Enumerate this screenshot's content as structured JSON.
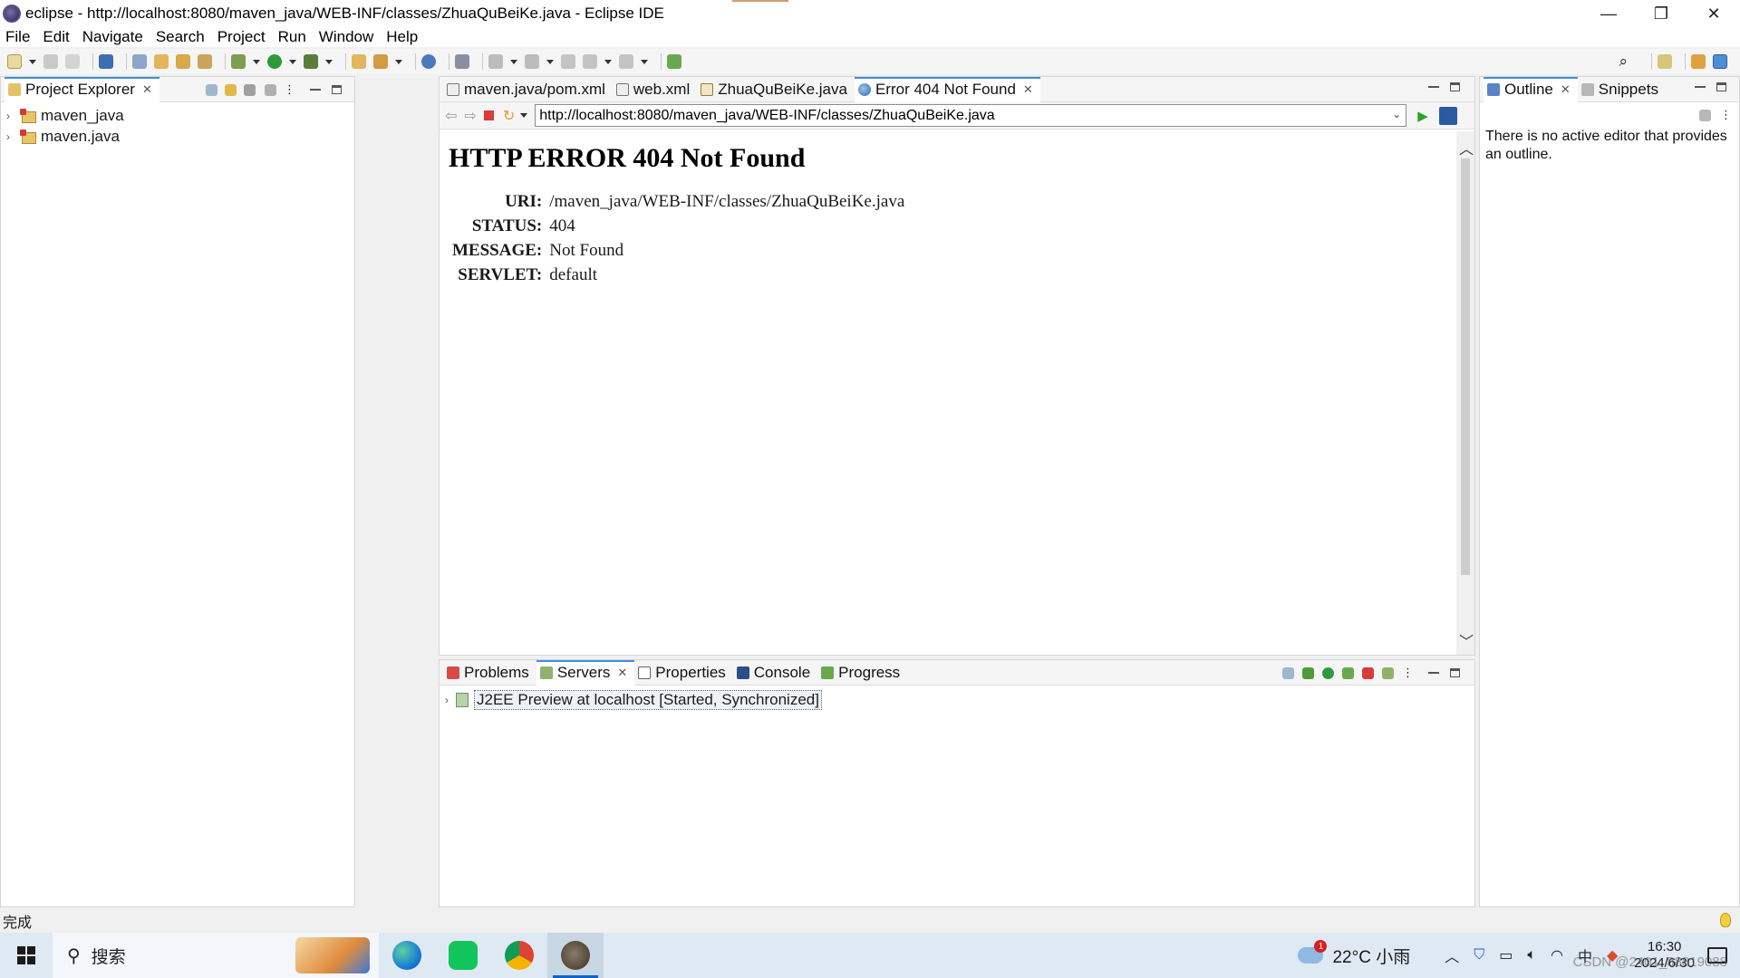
{
  "window": {
    "title": "eclipse - http://localhost:8080/maven_java/WEB-INF/classes/ZhuaQuBeiKe.java - Eclipse IDE",
    "minimize": "—",
    "restore": "❐",
    "close": "✕"
  },
  "menu": [
    "File",
    "Edit",
    "Navigate",
    "Search",
    "Project",
    "Run",
    "Window",
    "Help"
  ],
  "project_explorer": {
    "tab_label": "Project Explorer",
    "items": [
      {
        "label": "maven_java"
      },
      {
        "label": "maven.java"
      }
    ]
  },
  "editor": {
    "tabs": [
      {
        "label": "maven.java/pom.xml",
        "icon": "xml-file-icon"
      },
      {
        "label": "web.xml",
        "icon": "xml-file-icon"
      },
      {
        "label": "ZhuaQuBeiKe.java",
        "icon": "java-file-icon"
      },
      {
        "label": "Error 404 Not Found",
        "icon": "globe-icon",
        "active": true
      }
    ],
    "url": "http://localhost:8080/maven_java/WEB-INF/classes/ZhuaQuBeiKe.java",
    "page": {
      "heading": "HTTP ERROR 404 Not Found",
      "rows": [
        {
          "key": "URI:",
          "value": "/maven_java/WEB-INF/classes/ZhuaQuBeiKe.java"
        },
        {
          "key": "STATUS:",
          "value": "404"
        },
        {
          "key": "MESSAGE:",
          "value": "Not Found"
        },
        {
          "key": "SERVLET:",
          "value": "default"
        }
      ]
    }
  },
  "bottom_panel": {
    "tabs": [
      {
        "label": "Problems",
        "icon": "problems-icon"
      },
      {
        "label": "Servers",
        "icon": "servers-icon",
        "active": true
      },
      {
        "label": "Properties",
        "icon": "properties-icon"
      },
      {
        "label": "Console",
        "icon": "console-icon"
      },
      {
        "label": "Progress",
        "icon": "progress-icon"
      }
    ],
    "server": "J2EE Preview at localhost  [Started, Synchronized]"
  },
  "outline": {
    "tabs": [
      {
        "label": "Outline",
        "active": true
      },
      {
        "label": "Snippets"
      }
    ],
    "message": "There is no active editor that provides an outline."
  },
  "status_bar": {
    "text": "完成"
  },
  "taskbar": {
    "search_label": "搜索",
    "weather": "22°C  小雨",
    "weather_badge": "1",
    "time": "16:30",
    "date": "2024/6/30",
    "watermark": "CSDN @2401_88819088"
  },
  "colors": {
    "active_tab_accent": "#3e8ede",
    "taskbar_bg": "#dfe9f3",
    "stop_red": "#d93b3b"
  }
}
